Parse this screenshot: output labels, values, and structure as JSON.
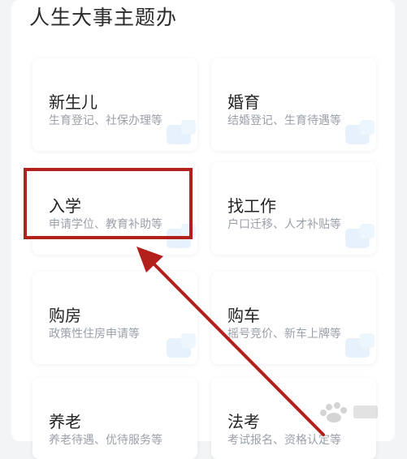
{
  "section": {
    "title": "人生大事主题办"
  },
  "cards": [
    {
      "title": "新生儿",
      "desc": "生育登记、社保办理等"
    },
    {
      "title": "婚育",
      "desc": "结婚登记、生育待遇等"
    },
    {
      "title": "入学",
      "desc": "申请学位、教育补助等"
    },
    {
      "title": "找工作",
      "desc": "户口迁移、人才补贴等"
    },
    {
      "title": "购房",
      "desc": "政策性住房申请等"
    },
    {
      "title": "购车",
      "desc": "摇号竞价、新车上牌等"
    },
    {
      "title": "养老",
      "desc": "养老待遇、优待服务等"
    },
    {
      "title": "法考",
      "desc": "考试报名、资格认定等"
    }
  ],
  "annotation": {
    "highlight_color": "#b3201c"
  }
}
